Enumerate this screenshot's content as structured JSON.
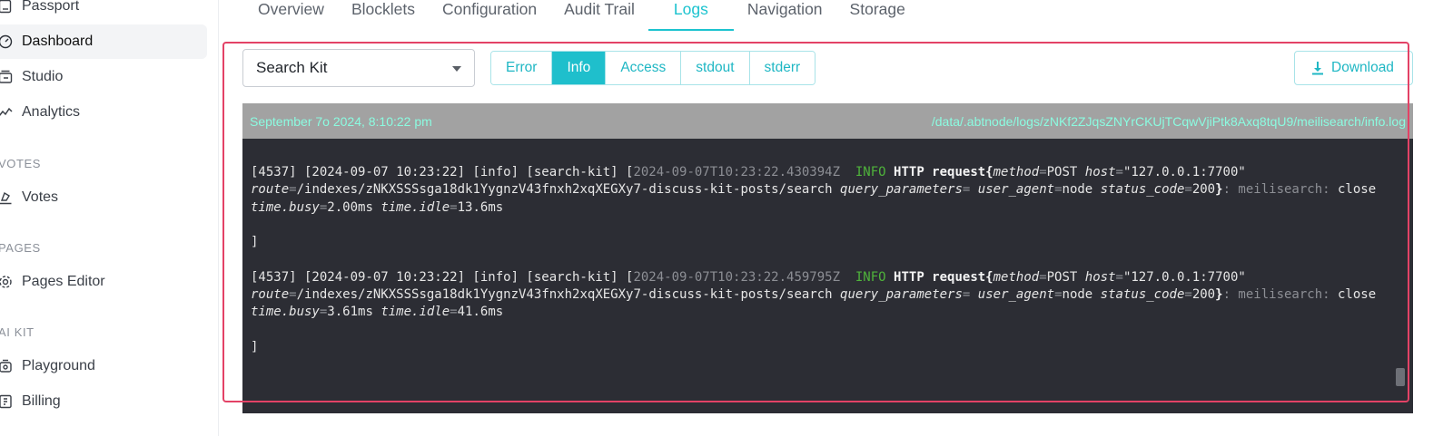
{
  "sidebar": {
    "items": [
      {
        "label": "Passport",
        "icon": "passport-icon"
      },
      {
        "label": "Dashboard",
        "icon": "gauge-icon",
        "active": true
      },
      {
        "label": "Studio",
        "icon": "studio-icon"
      },
      {
        "label": "Analytics",
        "icon": "chart-line-icon"
      }
    ],
    "sections": [
      {
        "title": "VOTES",
        "items": [
          {
            "label": "Votes",
            "icon": "vote-icon"
          }
        ]
      },
      {
        "title": "PAGES",
        "items": [
          {
            "label": "Pages Editor",
            "icon": "gear-icon"
          }
        ]
      },
      {
        "title": "AI KIT",
        "items": [
          {
            "label": "Playground",
            "icon": "playground-icon"
          },
          {
            "label": "Billing",
            "icon": "billing-icon"
          }
        ]
      }
    ]
  },
  "tabs": [
    "Overview",
    "Blocklets",
    "Configuration",
    "Audit Trail",
    "Logs",
    "Navigation",
    "Storage"
  ],
  "active_tab": "Logs",
  "toolbar": {
    "select_value": "Search Kit",
    "log_types": [
      "Error",
      "Info",
      "Access",
      "stdout",
      "stderr"
    ],
    "active_log_type": "Info",
    "download_label": "Download"
  },
  "log": {
    "date": "September 7o 2024, 8:10:22 pm",
    "path": "/data/.abtnode/logs/zNKf2ZJqsZNYrCKUjTCqwVjiPtk8Axq8tqU9/meilisearch/info.log",
    "entries": [
      {
        "prefix": "[4537] [2024-09-07 10:23:22] [info] [search-kit] [",
        "timestamp": "2024-09-07T10:23:22.430394Z",
        "level": "INFO",
        "message": "HTTP request{",
        "method_key": "method",
        "method_val": "POST",
        "host_key": "host",
        "host_val": "\"127.0.0.1:7700\"",
        "route_key": "route",
        "route_val": "/indexes/zNKXSSSsga18dk1YygnzV43fnxh2xqXEGXy7-discuss-kit-posts/search",
        "qp_key": "query_parameters",
        "ua_key": "user_agent",
        "ua_val": "node",
        "status_key": "status_code",
        "status_val": "200",
        "close_brace": "}",
        "target": ": meilisearch:",
        "close_word": " close ",
        "busy_key": "time.busy",
        "busy_val": "2.00ms",
        "idle_key": "time.idle",
        "idle_val": "13.6ms",
        "trailer": "]"
      },
      {
        "prefix": "[4537] [2024-09-07 10:23:22] [info] [search-kit] [",
        "timestamp": "2024-09-07T10:23:22.459795Z",
        "level": "INFO",
        "message": "HTTP request{",
        "method_key": "method",
        "method_val": "POST",
        "host_key": "host",
        "host_val": "\"127.0.0.1:7700\"",
        "route_key": "route",
        "route_val": "/indexes/zNKXSSSsga18dk1YygnzV43fnxh2xqXEGXy7-discuss-kit-posts/search",
        "qp_key": "query_parameters",
        "ua_key": "user_agent",
        "ua_val": "node",
        "status_key": "status_code",
        "status_val": "200",
        "close_brace": "}",
        "target": ": meilisearch:",
        "close_word": " close ",
        "busy_key": "time.busy",
        "busy_val": "3.61ms",
        "idle_key": "time.idle",
        "idle_val": "41.6ms",
        "trailer": "]"
      }
    ]
  },
  "colors": {
    "accent": "#1fbfcc",
    "highlight": "#e34266",
    "log_bg": "#2c2d34",
    "log_header_bg": "#a2a2a2",
    "log_header_text": "#8bfbe0",
    "info_green": "#4fb33b"
  }
}
